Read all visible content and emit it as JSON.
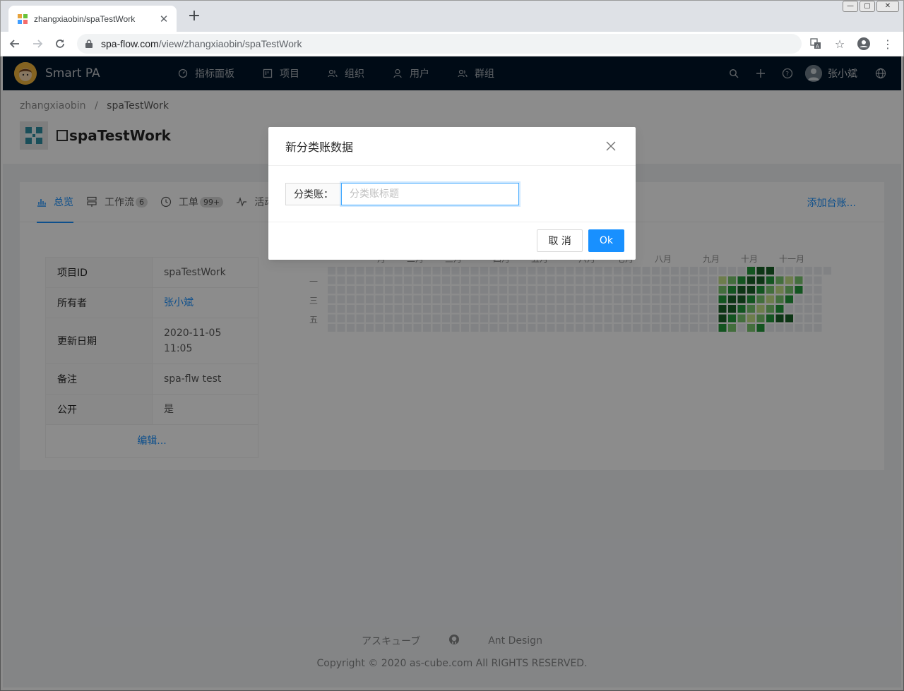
{
  "browser": {
    "tab_title": "zhangxiaobin/spaTestWork",
    "url_host": "spa-flow.com",
    "url_path": "/view/zhangxiaobin/spaTestWork"
  },
  "app": {
    "name": "Smart PA",
    "menu": [
      {
        "label": "指标面板",
        "icon": "dashboard-icon"
      },
      {
        "label": "项目",
        "icon": "project-icon"
      },
      {
        "label": "组织",
        "icon": "team-icon"
      },
      {
        "label": "用户",
        "icon": "user-icon"
      },
      {
        "label": "群组",
        "icon": "group-icon"
      }
    ],
    "user_name": "张小斌"
  },
  "breadcrumb": {
    "owner": "zhangxiaobin",
    "separator": "/",
    "project": "spaTestWork"
  },
  "project_title": "spaTestWork",
  "tabs": [
    {
      "label": "总览",
      "badge": ""
    },
    {
      "label": "工作流",
      "badge": "6"
    },
    {
      "label": "工单",
      "badge": "99+"
    },
    {
      "label": "活动",
      "badge": ""
    }
  ],
  "add_ledger": "添加台账...",
  "info": {
    "rows": [
      {
        "key": "项目ID",
        "value": "spaTestWork"
      },
      {
        "key": "所有者",
        "value": "张小斌"
      },
      {
        "key": "更新日期",
        "value": "2020-11-05 11:05"
      },
      {
        "key": "备注",
        "value": "spa-flw test"
      },
      {
        "key": "公开",
        "value": "是"
      }
    ],
    "edit_label": "编辑..."
  },
  "heatmap": {
    "months": [
      "一月",
      "二月",
      "三月",
      "四月",
      "五月",
      "六月",
      "七月",
      "八月",
      "九月",
      "十月",
      "十一月"
    ],
    "weekdays": [
      "一",
      "三",
      "五"
    ],
    "colors": {
      "empty": "#ebedf0",
      "l1": "#c6e48b",
      "l2": "#7bc96f",
      "l3": "#239a3b",
      "l4": "#196127"
    }
  },
  "footer": {
    "link1": "アスキューブ",
    "link3": "Ant Design",
    "copyright": "Copyright © 2020 as-cube.com All RIGHTS RESERVED."
  },
  "modal": {
    "title": "新分类账数据",
    "field_label": "分类账：",
    "field_placeholder": "分类账标题",
    "field_value": "",
    "cancel_label": "取 消",
    "ok_label": "Ok"
  },
  "theme": {
    "header_bg": "#001529",
    "primary": "#1890ff"
  }
}
